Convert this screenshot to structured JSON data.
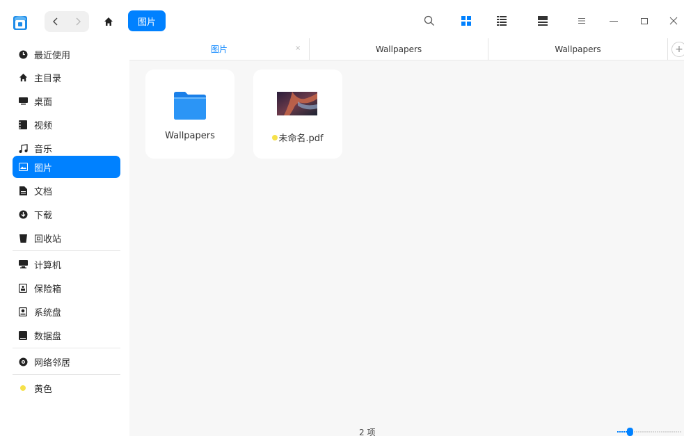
{
  "toolbar": {
    "back_icon": "chevron-left-icon",
    "forward_icon": "chevron-right-icon",
    "home_icon": "home-icon",
    "breadcrumb": "图片",
    "search_icon": "search-icon",
    "icon_view_icon": "grid-view-icon",
    "list_view_icon": "list-view-icon",
    "detail_view_icon": "detail-view-icon",
    "menu_icon": "hamburger-menu-icon"
  },
  "sidebar": {
    "items": [
      {
        "label": "最近使用",
        "icon": "clock-icon"
      },
      {
        "label": "主目录",
        "icon": "home-icon"
      },
      {
        "label": "桌面",
        "icon": "desktop-icon"
      },
      {
        "label": "视频",
        "icon": "video-icon"
      },
      {
        "label": "音乐",
        "icon": "music-icon"
      },
      {
        "label": "图片",
        "icon": "picture-icon",
        "active": true
      },
      {
        "label": "文档",
        "icon": "document-icon"
      },
      {
        "label": "下载",
        "icon": "download-icon"
      },
      {
        "label": "回收站",
        "icon": "trash-icon"
      },
      {
        "label": "计算机",
        "icon": "computer-icon"
      },
      {
        "label": "保险箱",
        "icon": "vault-icon"
      },
      {
        "label": "系统盘",
        "icon": "system-disk-icon"
      },
      {
        "label": "数据盘",
        "icon": "data-disk-icon"
      },
      {
        "label": "网络邻居",
        "icon": "network-icon"
      },
      {
        "label": "黄色",
        "icon": "yellow-tag-icon"
      }
    ]
  },
  "tabs": [
    {
      "label": "图片",
      "active": true
    },
    {
      "label": "Wallpapers"
    },
    {
      "label": "Wallpapers"
    }
  ],
  "tab_close": "×",
  "add_tab": "+",
  "files": [
    {
      "name": "Wallpapers",
      "type": "folder"
    },
    {
      "name": "未命名.pdf",
      "type": "pdf",
      "tag": "yellow"
    }
  ],
  "status": {
    "item_count": "2 项"
  },
  "zoom": {
    "level": 0.2
  },
  "colors": {
    "accent": "#0081ff",
    "tag_yellow": "#f6e14a",
    "folder": "#2b95f6"
  }
}
